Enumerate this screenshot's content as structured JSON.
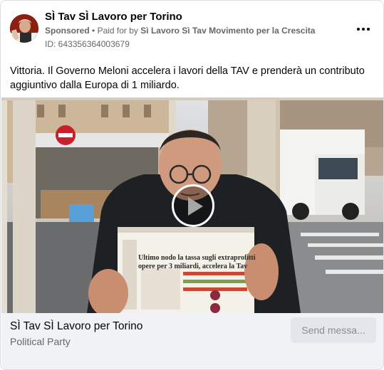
{
  "header": {
    "page_name": "SÌ Tav SÌ Lavoro per Torino",
    "sponsored": "Sponsored",
    "separator": "•",
    "paid_for_prefix": "Paid for by",
    "paid_for_by": "Sì Lavoro Sì Tav Movimento per la Crescita",
    "ad_id": "ID: 643356364003679",
    "more_icon": "more-horizontal-icon"
  },
  "post": {
    "text": "Vittoria. Il Governo Meloni accelera i lavori della TAV e prenderà un contributo aggiuntivo dalla Europa di 1 miliardo."
  },
  "media": {
    "type": "video",
    "play_icon": "play-icon",
    "newspaper_headline_line1": "Ultimo nodo la tassa sugli extraprofitti",
    "newspaper_headline_line2": "opere per 3 miliardi, accelera la Tav"
  },
  "footer": {
    "title": "SÌ Tav SÌ Lavoro per Torino",
    "subtitle": "Political Party",
    "button_label": "Send messa..."
  },
  "colors": {
    "card_border": "#dadde1",
    "footer_bg": "#f0f2f5",
    "button_bg": "#e4e6eb",
    "secondary_text": "#65676b"
  }
}
